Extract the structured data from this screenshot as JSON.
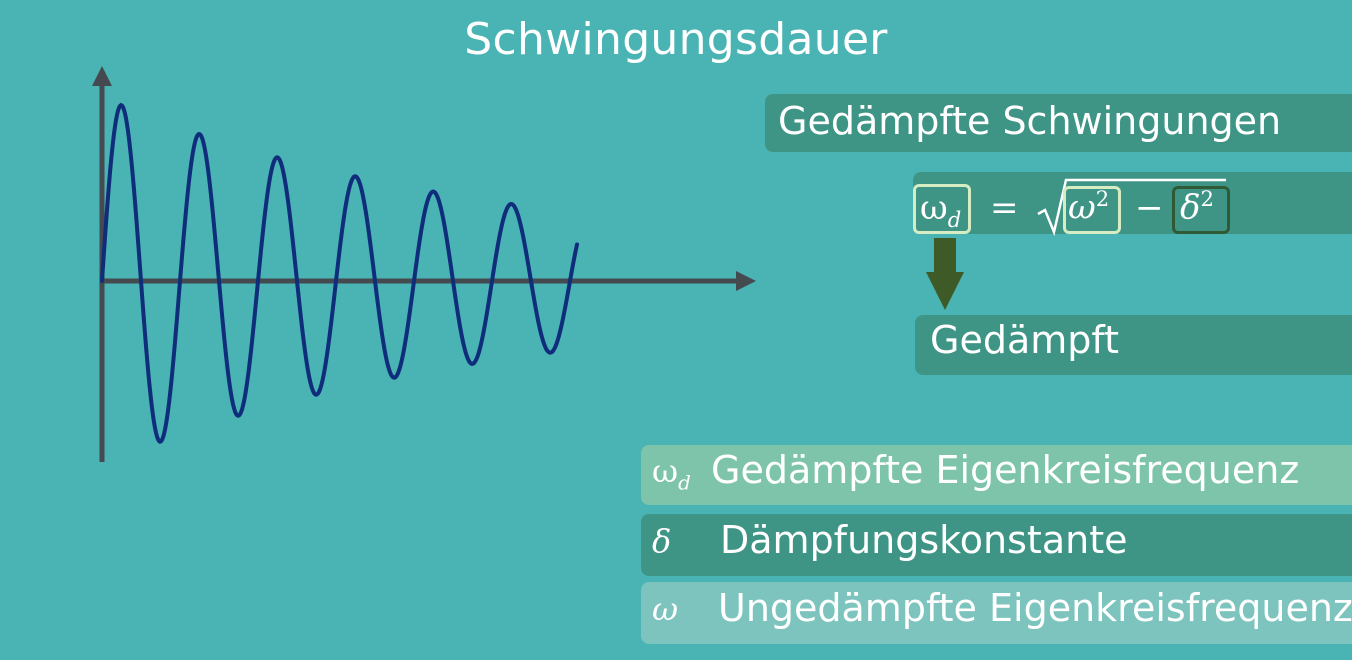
{
  "title": "Schwingungsdauer",
  "heading": "Gedämpfte Schwingungen",
  "formula": {
    "lhs": "ω",
    "lhs_sub": "d",
    "equals": "=",
    "omega": "ω",
    "omega_exp": "2",
    "minus": "−",
    "delta": "δ",
    "delta_exp": "2"
  },
  "result_label": "Gedämpft",
  "legend": [
    {
      "symbol": "ω",
      "symbol_sub": "d",
      "text": "Gedämpfte Eigenkreisfrequenz"
    },
    {
      "symbol": "δ",
      "symbol_sub": "",
      "text": "Dämpfungskonstante"
    },
    {
      "symbol": "ω",
      "symbol_sub": "",
      "text": "Ungedämpfte Eigenkreisfrequenz"
    }
  ],
  "colors": {
    "background": "#4ab3b3",
    "wave": "#0f2d7a",
    "axis": "#444a4f",
    "bar_dark": "#3f9585",
    "bar_light": "#7ec4ab",
    "box_light": "#d6ecc3",
    "box_dark": "#2f5a36",
    "arrow": "#3e5a26"
  }
}
